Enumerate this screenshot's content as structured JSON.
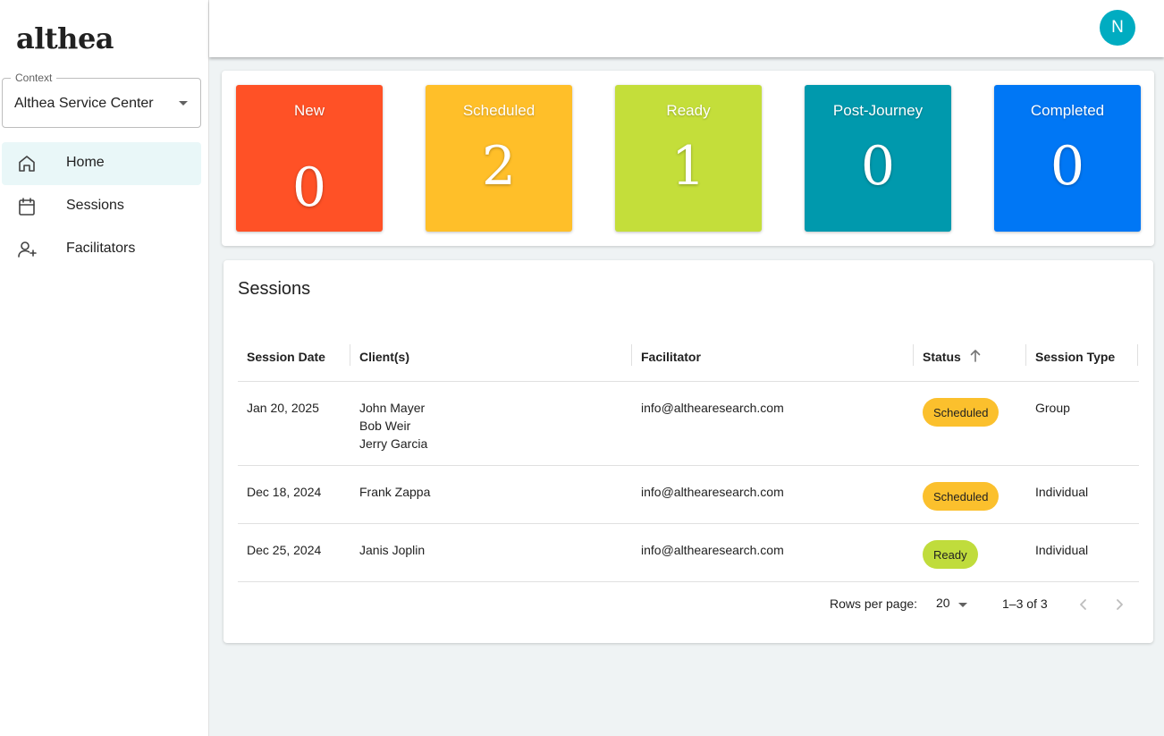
{
  "sidebar": {
    "logo": "althea",
    "context": {
      "legend": "Context",
      "value": "Althea Service Center"
    },
    "nav": [
      {
        "label": "Home",
        "icon": "home-icon",
        "active": true
      },
      {
        "label": "Sessions",
        "icon": "calendar-icon",
        "active": false
      },
      {
        "label": "Facilitators",
        "icon": "person-add-icon",
        "active": false
      }
    ]
  },
  "topbar": {
    "avatar_initial": "N",
    "avatar_color": "#00acc1"
  },
  "status_tiles": [
    {
      "label": "New",
      "value": "0",
      "color": "#ff5126"
    },
    {
      "label": "Scheduled",
      "value": "2",
      "color": "#ffbf29"
    },
    {
      "label": "Ready",
      "value": "1",
      "color": "#c4de3a"
    },
    {
      "label": "Post-Journey",
      "value": "0",
      "color": "#0099ad"
    },
    {
      "label": "Completed",
      "value": "0",
      "color": "#0077f5"
    }
  ],
  "sessions": {
    "title": "Sessions",
    "columns": [
      "Session Date",
      "Client(s)",
      "Facilitator",
      "Status",
      "Session Type"
    ],
    "sort": {
      "column": "Status",
      "direction": "ascending",
      "icon": "arrow-up-icon"
    },
    "rows": [
      {
        "date": "Jan 20, 2025",
        "clients": [
          "John Mayer",
          "Bob Weir",
          "Jerry Garcia"
        ],
        "facilitator": "info@althearesearch.com",
        "status": "Scheduled",
        "status_color": "#fbc02d",
        "type": "Group"
      },
      {
        "date": "Dec 18, 2024",
        "clients": [
          "Frank Zappa"
        ],
        "facilitator": "info@althearesearch.com",
        "status": "Scheduled",
        "status_color": "#fbc02d",
        "type": "Individual"
      },
      {
        "date": "Dec 25, 2024",
        "clients": [
          "Janis Joplin"
        ],
        "facilitator": "info@althearesearch.com",
        "status": "Ready",
        "status_color": "#c0dc3c",
        "type": "Individual"
      }
    ],
    "pagination": {
      "rows_per_page_label": "Rows per page:",
      "rows_per_page": "20",
      "range": "1–3 of 3"
    }
  }
}
